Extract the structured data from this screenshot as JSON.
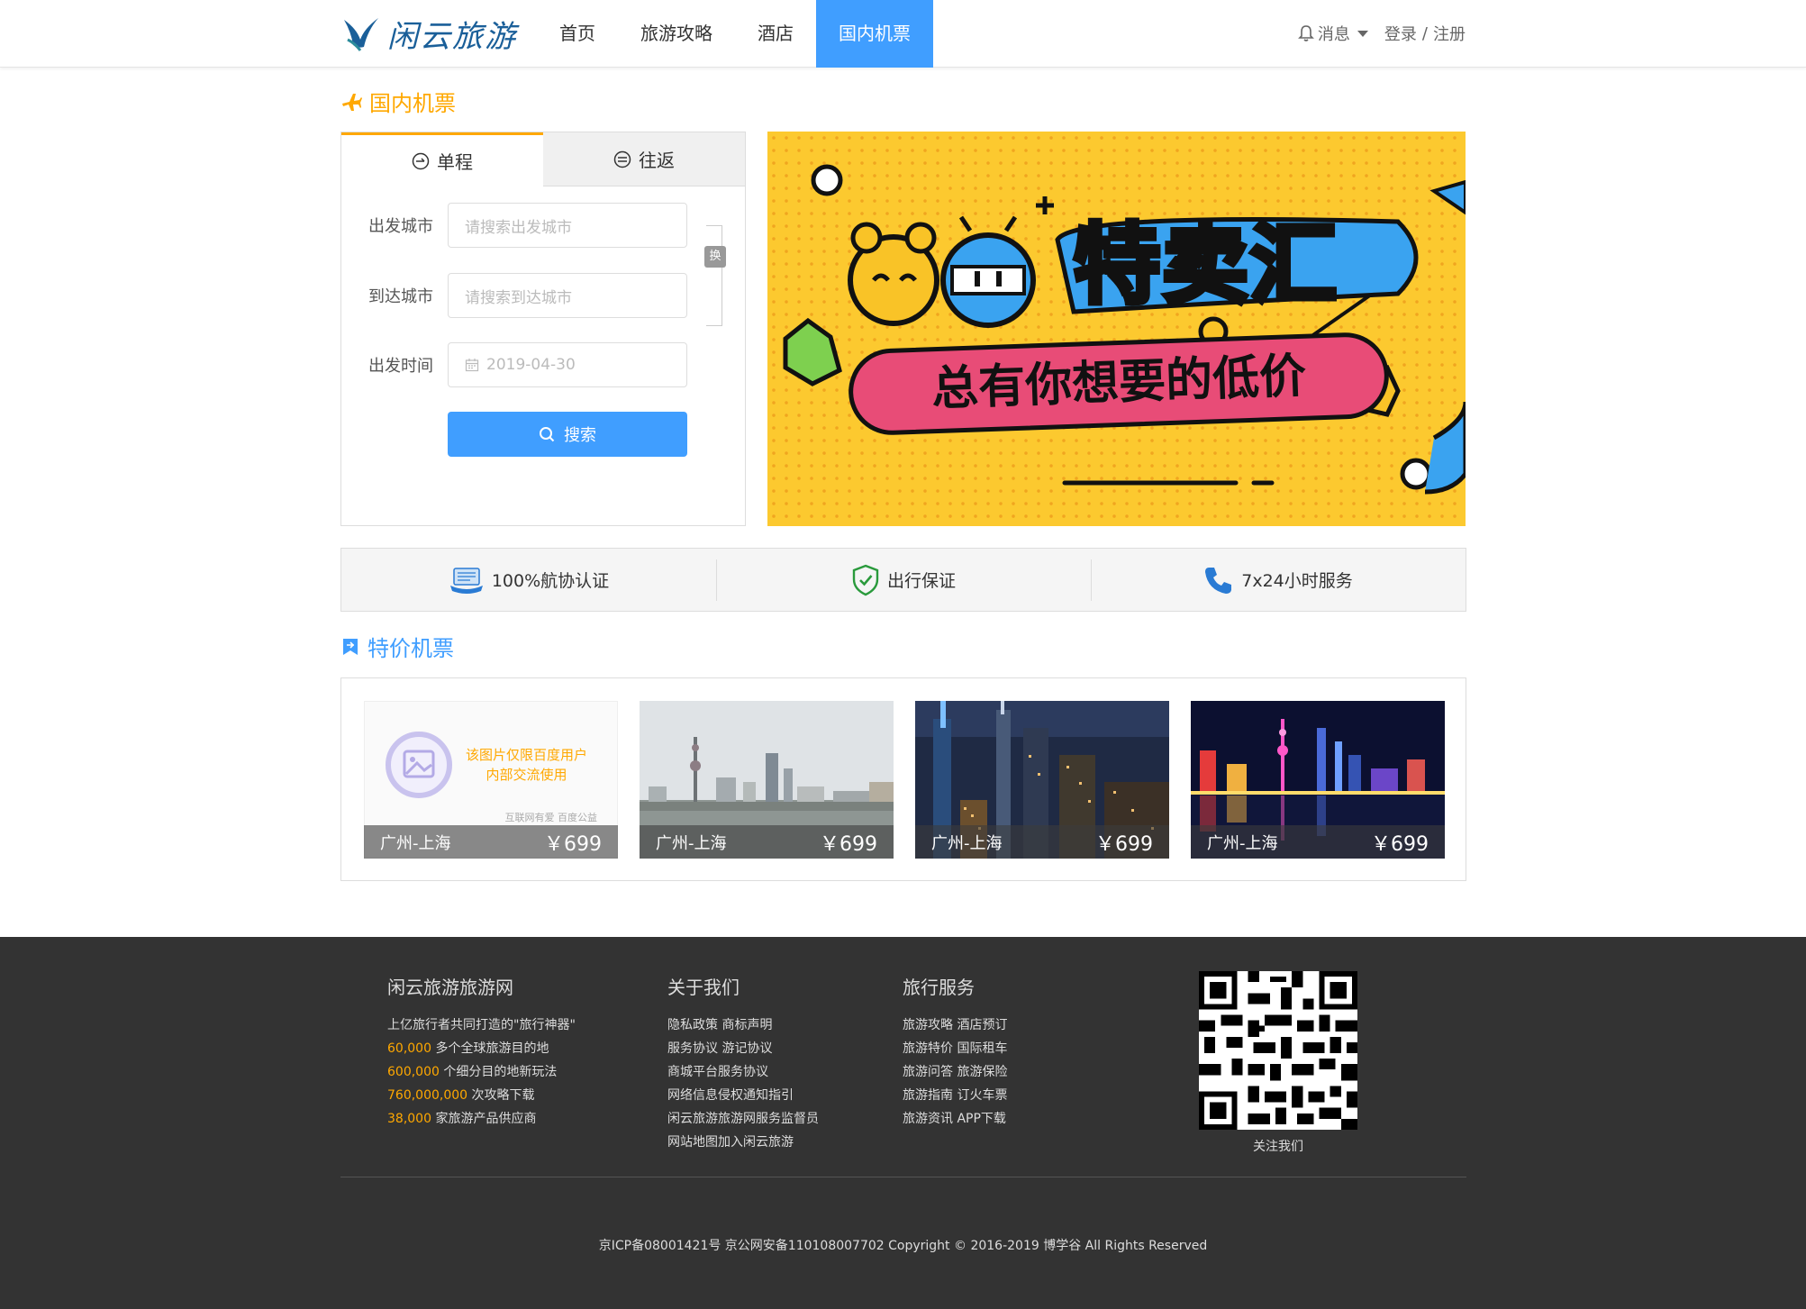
{
  "header": {
    "logo_text": "闲云旅游",
    "nav": [
      {
        "label": "首页"
      },
      {
        "label": "旅游攻略"
      },
      {
        "label": "酒店"
      },
      {
        "label": "国内机票"
      }
    ],
    "messages_label": "消息",
    "login_label": "登录",
    "separator": "/",
    "register_label": "注册",
    "accent_color": "#409eff"
  },
  "flight_section": {
    "title": "国内机票",
    "title_color": "#ffa800",
    "tabs": [
      {
        "label": "单程",
        "active": true
      },
      {
        "label": "往返",
        "active": false
      }
    ],
    "fields": {
      "depart_label": "出发城市",
      "depart_placeholder": "请搜索出发城市",
      "arrive_label": "到达城市",
      "arrive_placeholder": "请搜索到达城市",
      "date_label": "出发时间",
      "date_value": "2019-04-30"
    },
    "swap_label": "换",
    "search_label": "搜索"
  },
  "banner": {
    "title": "特卖汇",
    "subtitle": "总有你想要的低价"
  },
  "features": [
    {
      "label": "100%航协认证",
      "icon": "certificate-icon"
    },
    {
      "label": "出行保证",
      "icon": "shield-check-icon"
    },
    {
      "label": "7x24小时服务",
      "icon": "phone-icon"
    }
  ],
  "deals_section": {
    "title": "特价机票",
    "title_color": "#409eff",
    "placeholder_text_line1": "该图片仅限百度用户",
    "placeholder_text_line2": "内部交流使用",
    "placeholder_foot": "互联网有爱 百度公益",
    "cards": [
      {
        "route": "广州-上海",
        "price": "￥699",
        "image": "placeholder"
      },
      {
        "route": "广州-上海",
        "price": "￥699",
        "image": "shanghai-day"
      },
      {
        "route": "广州-上海",
        "price": "￥699",
        "image": "shanghai-night-aerial"
      },
      {
        "route": "广州-上海",
        "price": "￥699",
        "image": "shanghai-night-bund"
      }
    ]
  },
  "footer": {
    "col1": {
      "title": "闲云旅游旅游网",
      "intro": "上亿旅行者共同打造的\"旅行神器\"",
      "stats": [
        {
          "num": "60,000",
          "text": " 多个全球旅游目的地"
        },
        {
          "num": "600,000",
          "text": " 个细分目的地新玩法"
        },
        {
          "num": "760,000,000",
          "text": " 次攻略下载"
        },
        {
          "num": "38,000",
          "text": " 家旅游产品供应商"
        }
      ]
    },
    "col2": {
      "title": "关于我们",
      "links": [
        "隐私政策 商标声明",
        "服务协议 游记协议",
        "商城平台服务协议",
        "网络信息侵权通知指引",
        "闲云旅游旅游网服务监督员",
        "网站地图加入闲云旅游"
      ]
    },
    "col3": {
      "title": "旅行服务",
      "links": [
        "旅游攻略 酒店预订",
        "旅游特价 国际租车",
        "旅游问答 旅游保险",
        "旅游指南 订火车票",
        "旅游资讯 APP下载"
      ]
    },
    "qr_label": "关注我们",
    "copyright": "京ICP备08001421号 京公网安备110108007702 Copyright © 2016-2019 博学谷 All Rights Reserved"
  }
}
